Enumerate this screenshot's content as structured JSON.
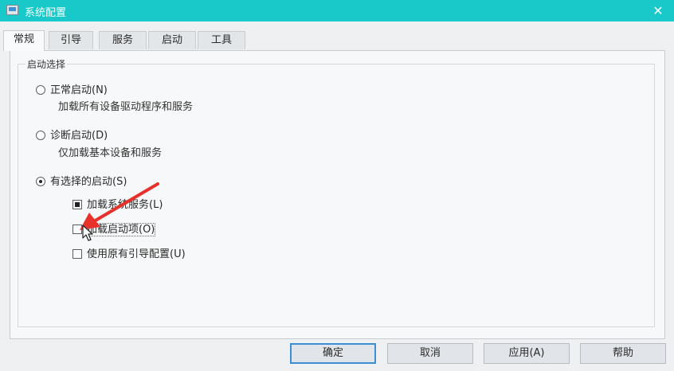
{
  "window": {
    "title": "系统配置",
    "close_glyph": "✕"
  },
  "tabs": [
    {
      "label": "常规",
      "active": true
    },
    {
      "label": "引导"
    },
    {
      "label": "服务"
    },
    {
      "label": "启动"
    },
    {
      "label": "工具"
    }
  ],
  "startup": {
    "group_label": "启动选择",
    "normal": {
      "label": "正常启动(N)",
      "desc": "加载所有设备驱动程序和服务",
      "checked": false
    },
    "diagnostic": {
      "label": "诊断启动(D)",
      "desc": "仅加载基本设备和服务",
      "checked": false
    },
    "selective": {
      "label": "有选择的启动(S)",
      "checked": true
    },
    "options": [
      {
        "label": "加载系统服务(L)",
        "state": "mixed"
      },
      {
        "label": "加载启动项(O)",
        "state": "unchecked"
      },
      {
        "label": "使用原有引导配置(U)",
        "state": "unchecked"
      }
    ]
  },
  "buttons": {
    "ok": "确定",
    "cancel": "取消",
    "apply": "应用(A)",
    "help": "帮助"
  },
  "colors": {
    "titlebar": "#19c9c9",
    "annotation_arrow": "#e8312a"
  }
}
